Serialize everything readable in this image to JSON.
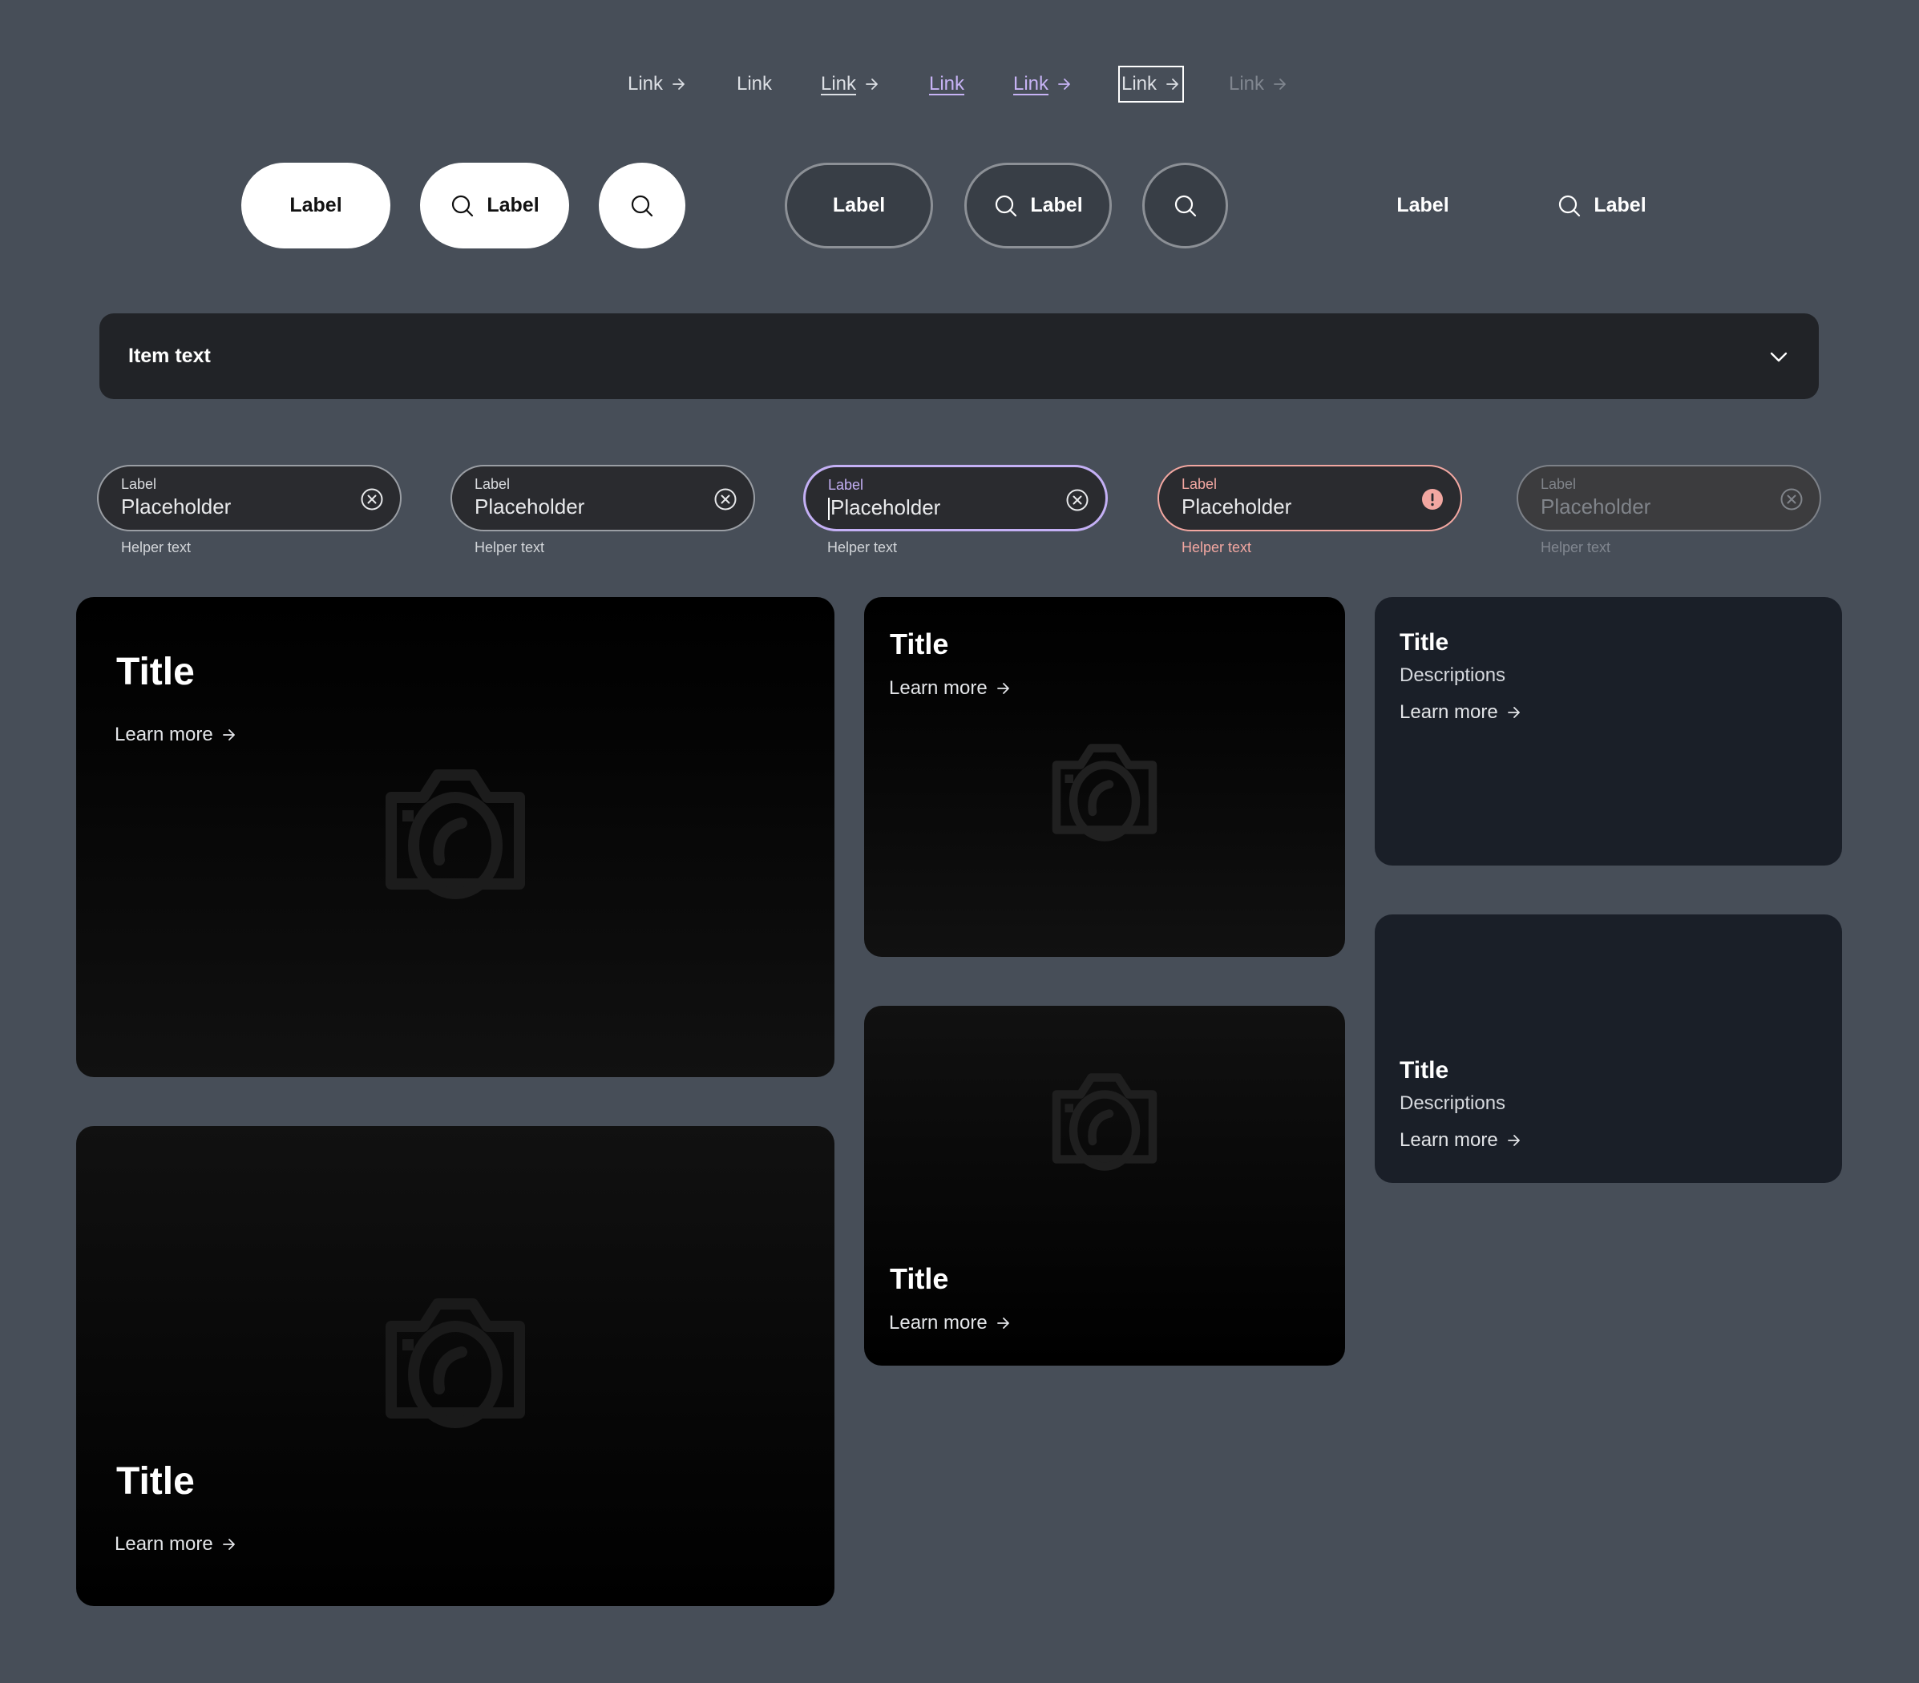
{
  "colors": {
    "background": "#474e58",
    "visited_link": "#c7b3f5",
    "focus_border": "#c4b0f5",
    "error": "#f2a7a1",
    "card_plain": "#1a1f28",
    "dropdown_bg": "#212327"
  },
  "links": [
    {
      "label": "Link",
      "state": "default-with-arrow",
      "icon": "arrow-right-icon"
    },
    {
      "label": "Link",
      "state": "default"
    },
    {
      "label": "Link",
      "state": "underlined-with-arrow",
      "icon": "arrow-right-icon"
    },
    {
      "label": "Link",
      "state": "visited"
    },
    {
      "label": "Link",
      "state": "visited-with-arrow",
      "icon": "arrow-right-icon"
    },
    {
      "label": "Link",
      "state": "focused",
      "icon": "arrow-right-icon"
    },
    {
      "label": "Link",
      "state": "disabled",
      "icon": "arrow-right-icon"
    }
  ],
  "buttons": {
    "primary": [
      {
        "label": "Label"
      },
      {
        "label": "Label",
        "icon": "search-icon"
      },
      {
        "icon": "search-icon"
      }
    ],
    "outline": [
      {
        "label": "Label"
      },
      {
        "label": "Label",
        "icon": "search-icon"
      },
      {
        "icon": "search-icon"
      }
    ],
    "ghost": [
      {
        "label": "Label"
      },
      {
        "label": "Label",
        "icon": "search-icon"
      }
    ]
  },
  "dropdown": {
    "text": "Item text",
    "icon": "chevron-down-icon"
  },
  "inputs": [
    {
      "state": "default",
      "label": "Label",
      "placeholder": "Placeholder",
      "helper": "Helper text",
      "icon": "clear-icon"
    },
    {
      "state": "hover",
      "label": "Label",
      "placeholder": "Placeholder",
      "helper": "Helper text",
      "icon": "clear-icon"
    },
    {
      "state": "focused",
      "label": "Label",
      "placeholder": "Placeholder",
      "helper": "Helper text",
      "icon": "clear-icon"
    },
    {
      "state": "error",
      "label": "Label",
      "placeholder": "Placeholder",
      "helper": "Helper text",
      "icon": "error-icon"
    },
    {
      "state": "disabled",
      "label": "Label",
      "placeholder": "Placeholder",
      "helper": "Helper text",
      "icon": "clear-icon"
    }
  ],
  "cards": [
    {
      "title": "Title",
      "link": "Learn more",
      "variant": "image-large-top"
    },
    {
      "title": "Title",
      "link": "Learn more",
      "variant": "image-large-bottom"
    },
    {
      "title": "Title",
      "link": "Learn more",
      "variant": "image-medium-top"
    },
    {
      "title": "Title",
      "link": "Learn more",
      "variant": "image-medium-bottom"
    },
    {
      "title": "Title",
      "description": "Descriptions",
      "link": "Learn more",
      "variant": "plain-top"
    },
    {
      "title": "Title",
      "description": "Descriptions",
      "link": "Learn more",
      "variant": "plain-bottom"
    }
  ]
}
